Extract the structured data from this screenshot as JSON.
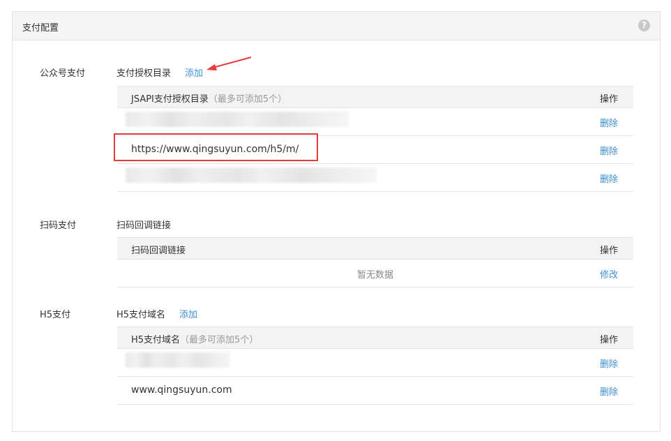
{
  "panel": {
    "title": "支付配置",
    "help": "?"
  },
  "sections": {
    "jsapi": {
      "label": "公众号支付",
      "sub_label": "支付授权目录",
      "add": "添加",
      "table": {
        "header": "JSAPI支付授权目录",
        "hint": "（最多可添加5个）",
        "op_header": "操作",
        "rows": [
          {
            "value": "",
            "op": "删除"
          },
          {
            "value": "https://www.qingsuyun.com/h5/m/",
            "op": "删除"
          },
          {
            "value": "",
            "op": "删除"
          }
        ]
      }
    },
    "scan": {
      "label": "扫码支付",
      "sub_label": "扫码回调链接",
      "table": {
        "header": "扫码回调链接",
        "op_header": "操作",
        "empty": "暂无数据",
        "op": "修改"
      }
    },
    "h5": {
      "label": "H5支付",
      "sub_label": "H5支付域名",
      "add": "添加",
      "table": {
        "header": "H5支付域名",
        "hint": "（最多可添加5个）",
        "op_header": "操作",
        "rows": [
          {
            "value": "",
            "op": "删除"
          },
          {
            "value": "www.qingsuyun.com",
            "op": "删除"
          }
        ]
      }
    }
  },
  "colors": {
    "link": "#3d8fd1",
    "highlight": "#e53b3b",
    "header_bg": "#f5f5f5"
  },
  "icons": {
    "help": "question-circle-icon",
    "annotation": "red-arrow-icon"
  }
}
